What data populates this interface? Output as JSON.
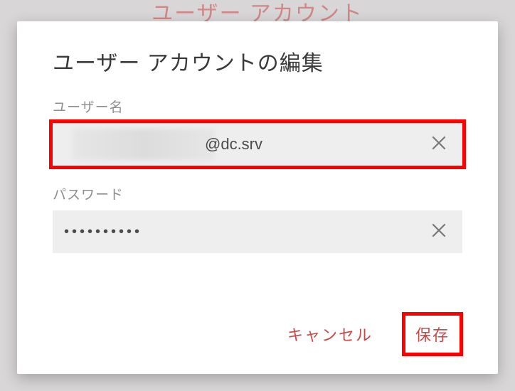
{
  "backdrop": {
    "title": "ユーザー アカウント"
  },
  "dialog": {
    "title": "ユーザー アカウントの編集",
    "fields": {
      "username": {
        "label": "ユーザー名",
        "value_suffix": "@dc.srv"
      },
      "password": {
        "label": "パスワード",
        "value": "••••••••••"
      }
    },
    "actions": {
      "cancel": "キャンセル",
      "save": "保存"
    }
  }
}
